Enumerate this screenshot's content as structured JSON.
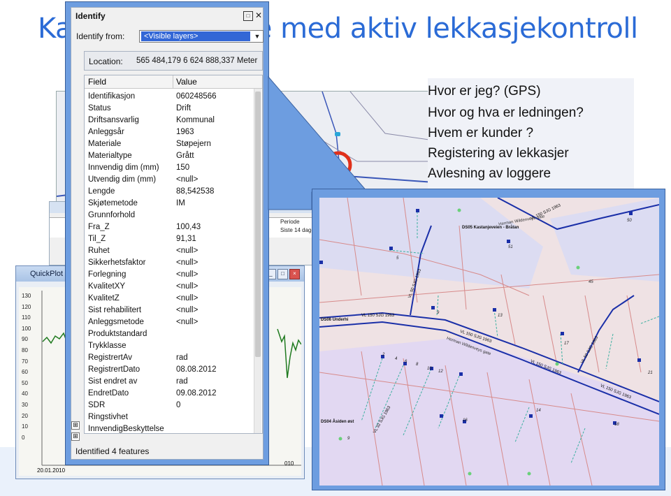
{
  "slide": {
    "title": "Kart og database med aktiv lekkasjekontroll",
    "callout_lines": [
      "Hvor er jeg? (GPS)",
      "Hvor og hva er ledningen?",
      "Hvem er kunder ?",
      "Registering av lekkasjer",
      "Avlesning av loggere"
    ]
  },
  "identify": {
    "window_title": "Identify",
    "identify_from_label": "Identify from:",
    "identify_from_value": "<Visible layers>",
    "location_label": "Location:",
    "location_value": "565 484,179  6 624 888,337 Meter",
    "col_field": "Field",
    "col_value": "Value",
    "rows": [
      {
        "field": "Identifikasjon",
        "value": "060248566"
      },
      {
        "field": "Status",
        "value": "Drift"
      },
      {
        "field": "Driftsansvarlig",
        "value": "Kommunal"
      },
      {
        "field": "Anleggsår",
        "value": "1963"
      },
      {
        "field": "Materiale",
        "value": "Støpejern"
      },
      {
        "field": "Materialtype",
        "value": "Grått"
      },
      {
        "field": "Innvendig dim (mm)",
        "value": "150"
      },
      {
        "field": "Utvendig dim (mm)",
        "value": "<null>"
      },
      {
        "field": "Lengde",
        "value": "88,542538"
      },
      {
        "field": "Skjøtemetode",
        "value": "IM"
      },
      {
        "field": "Grunnforhold",
        "value": ""
      },
      {
        "field": "Fra_Z",
        "value": "100,43"
      },
      {
        "field": "Til_Z",
        "value": "91,31"
      },
      {
        "field": "Ruhet",
        "value": "<null>"
      },
      {
        "field": "Sikkerhetsfaktor",
        "value": "<null>"
      },
      {
        "field": "Forlegning",
        "value": "<null>"
      },
      {
        "field": "KvalitetXY",
        "value": "<null>"
      },
      {
        "field": "KvalitetZ",
        "value": "<null>"
      },
      {
        "field": "Sist rehabilitert",
        "value": "<null>"
      },
      {
        "field": "Anleggsmetode",
        "value": "<null>"
      },
      {
        "field": "Produktstandard",
        "value": ""
      },
      {
        "field": "Trykklasse",
        "value": ""
      },
      {
        "field": "RegistrertAv",
        "value": "rad"
      },
      {
        "field": "RegistrertDato",
        "value": "08.08.2012"
      },
      {
        "field": "Sist endret av",
        "value": "rad"
      },
      {
        "field": "EndretDato",
        "value": "09.08.2012"
      },
      {
        "field": "SDR",
        "value": "0"
      },
      {
        "field": "Ringstivhet",
        "value": ""
      },
      {
        "field": "InnvendigBeskyttelse",
        "value": ""
      }
    ],
    "status": "Identified 4 features"
  },
  "quickplot": {
    "title": "QuickPlot",
    "y_ticks": [
      "130",
      "120",
      "110",
      "100",
      "90",
      "80",
      "70",
      "60",
      "50",
      "40",
      "30",
      "20",
      "10",
      "0"
    ],
    "x_first_label": "20.01.2010",
    "x_last_label": "010"
  },
  "table_window": {
    "col_periode": "Periode",
    "cell_periode": "Siste 14 dager"
  },
  "map": {
    "labels": {
      "ds05": "DS05 Kastanjeveien - Bråtan",
      "ds06": "DS06 Underhi",
      "ds04": "DS04 Åsiden øst",
      "street1": "Herman Wildenveys gate",
      "street2": "Herman Wildenveys gate",
      "pipe_main1": "VL 150 SJG 1963",
      "pipe_main2": "VL 150 SJG 1963",
      "pipe_main3": "VL 150 SJG 1963",
      "pipe_main4": "VL 150 SJG 1963",
      "pipe_vert": "VL 50 SJG 1963",
      "pipe_vert2": "VL 32 SJG 1963",
      "pipe_vert3": "VL 50 SJG 1963",
      "pipe_top": "VL 150 SJG 1963"
    },
    "house_numbers": [
      "50",
      "51",
      "5",
      "45",
      "9",
      "13",
      "17",
      "21",
      "2",
      "4",
      "6",
      "8",
      "10",
      "12",
      "14",
      "16",
      "18",
      "9"
    ]
  },
  "colors": {
    "title_blue": "#2b6bd6",
    "frame_blue": "#6d9de0",
    "pipe_blue": "#1a2fa8",
    "plot_green": "#1f7a1f"
  }
}
